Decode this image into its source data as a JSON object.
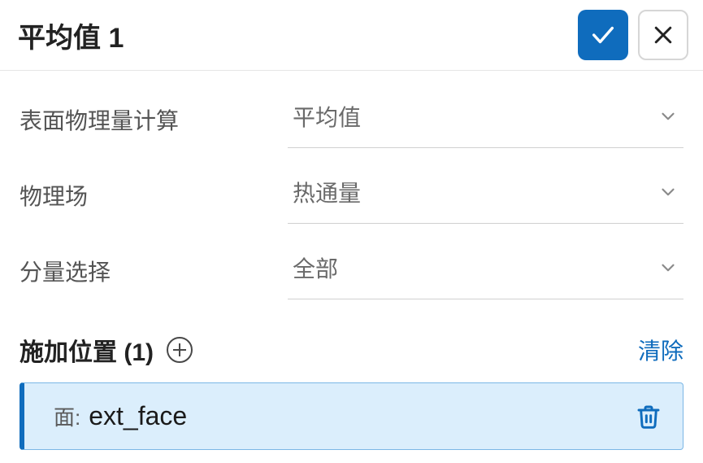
{
  "header": {
    "title": "平均值 1"
  },
  "fields": {
    "surface_calc": {
      "label": "表面物理量计算",
      "value": "平均值"
    },
    "physics": {
      "label": "物理场",
      "value": "热通量"
    },
    "component": {
      "label": "分量选择",
      "value": "全部"
    }
  },
  "locations": {
    "title": "施加位置 (1)",
    "clear_label": "清除",
    "items": [
      {
        "prefix": "面:",
        "name": "ext_face"
      }
    ]
  }
}
